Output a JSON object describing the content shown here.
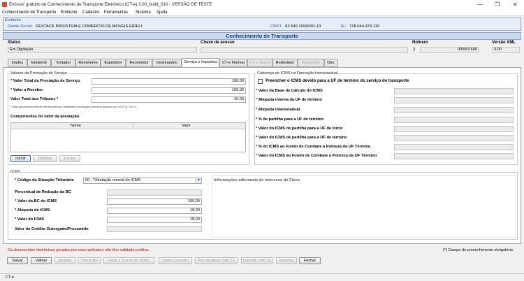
{
  "window": {
    "title": "Emissor gratuito de Conhecimento de Transporte Eletrônico (CT-e) 3.00_build_010 - VERSÃO DE TESTE",
    "minimize": "—",
    "maximize": "❐",
    "close": "✕"
  },
  "menu": [
    "Conhecimento de Transporte",
    "Emitente",
    "Cadastro",
    "Ferramentas",
    "Sistema",
    "Ajuda"
  ],
  "emitente": {
    "legend": "Emitente",
    "razao_label": "Razão Social:",
    "razao_value": "DESTACK INDUSTRIA E COMERCIO DE MOVEIS EIRELI",
    "cnpj_label": "CNPJ:",
    "cnpj_value": "03.540.116/0001-13",
    "ie_label": "IE:",
    "ie_value": "718.044.479.110"
  },
  "header": {
    "title": "Conhecimento de Transporte",
    "status_label": "Status",
    "status_value": "Em Digitação",
    "chave_label": "Chave de acesso",
    "chave_value": "",
    "numero_label": "Número",
    "numero_value": "000001600",
    "versao_label": "Versão XML",
    "versao_value": "3.00"
  },
  "tabs": [
    "Dados",
    "Emitente",
    "Tomador",
    "Remetente",
    "Expedidor",
    "Recebedor",
    "Destinatário",
    "Serviço e Impostos",
    "CT-e Normal",
    "CT-e Outros",
    "Rodoviário",
    "Aquaviário",
    "Obs."
  ],
  "valores": {
    "legend": "Valores da Prestação de Serviço",
    "total_label": "* Valor Total da Prestação de Serviço",
    "total_value": "100,00",
    "receber_label": "* Valor a Receber",
    "receber_value": "100,00",
    "tributos_label": "Valor Total dos Tributos *",
    "tributos_value": "10,00",
    "note": "* Valor aproximado total de tributos federais, estaduais e municipais conforme disposto na Lei nº 12.741/12.",
    "componentes_title": "Componentes do valor da prestação",
    "col_nome": "Nome",
    "col_valor": "Valor",
    "btn_incluir": "Incluir",
    "btn_detalhar": "Detalhar",
    "btn_excluir": "Excluir"
  },
  "cobranca": {
    "legend": "Cobrança do ICMS na Operação Interestadual",
    "checkbox_label": "Preencher o ICMS devido para a UF de término do serviço de transporte",
    "fields": [
      "* Valor da Base de Cálculo do ICMS",
      "* Alíquota interna da UF de término",
      "* Alíquota interestadual",
      "* % de partilha para a UF de término",
      "* Valor do ICMS de partilha para a UF de início",
      "* Valor do ICMS de partilha para a UF de término",
      "* % do ICMS ao Fundo de Combate à Pobreza da UF Término",
      "* Valor do ICMS ao Fundo de Combate à Pobreza da UF Término"
    ]
  },
  "icms": {
    "legend": "ICMS",
    "cst_label": "* Código da Situação Tributária",
    "cst_value": "00 - Tributação normal do ICMS",
    "reducao_label": "Percentual de Redução da BC",
    "reducao_value": "",
    "bc_label": "* Valor da BC do ICMS",
    "bc_value": "100,00",
    "aliq_label": "* Alíquota do ICMS",
    "aliq_value": "18,00",
    "valor_label": "* Valor do ICMS",
    "valor_value": "18,00",
    "credito_label": "Valor do Crédito Outorgado/Presumido",
    "credito_value": "",
    "info_fisco_label": "Informações adicionais de interesse do Fisco"
  },
  "footer": {
    "warning": "Os documentos eletrônicos gerados por esse aplicativo não têm validade jurídica.",
    "required_note": "(*) Campo de preenchimento obrigatório.",
    "buttons": [
      "Salvar",
      "Validar",
      "Assinar",
      "Transmitir",
      "Gerar e Transmitir EPEC",
      "Carta Correção",
      "Pré-visualizar DACTE",
      "Imprimir DACTE",
      "Exportar",
      "Fechar"
    ],
    "status": "CT-e"
  },
  "colors": {
    "accent": "#1a3f90",
    "warning": "#cc0000",
    "header_bg": "#c9daf1"
  }
}
